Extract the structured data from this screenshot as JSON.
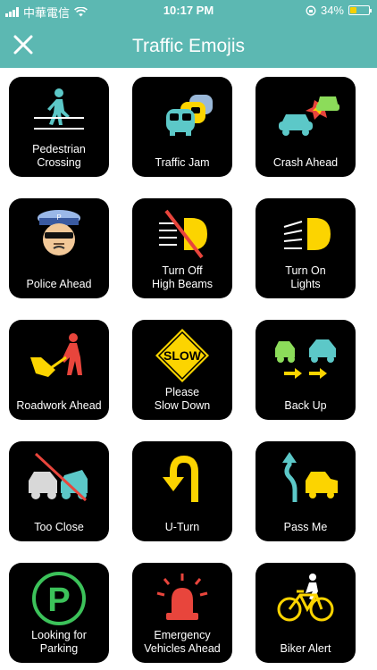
{
  "status_bar": {
    "carrier": "中華電信",
    "time": "10:17 PM",
    "battery": "34%",
    "battery_level": 0.34
  },
  "header": {
    "title": "Traffic Emojis",
    "close_icon": "close-icon"
  },
  "tiles": [
    {
      "label": "Pedestrian\nCrossing",
      "icon": "pedestrian-icon"
    },
    {
      "label": "Traffic Jam",
      "icon": "traffic-jam-icon"
    },
    {
      "label": "Crash Ahead",
      "icon": "crash-icon"
    },
    {
      "label": "Police Ahead",
      "icon": "police-icon"
    },
    {
      "label": "Turn Off\nHigh Beams",
      "icon": "high-beams-off-icon"
    },
    {
      "label": "Turn On\nLights",
      "icon": "lights-on-icon"
    },
    {
      "label": "Roadwork Ahead",
      "icon": "roadwork-icon"
    },
    {
      "label": "Please\nSlow Down",
      "icon": "slow-sign-icon"
    },
    {
      "label": "Back Up",
      "icon": "back-up-icon"
    },
    {
      "label": "Too Close",
      "icon": "too-close-icon"
    },
    {
      "label": "U-Turn",
      "icon": "u-turn-icon"
    },
    {
      "label": "Pass Me",
      "icon": "pass-me-icon"
    },
    {
      "label": "Looking for\nParking",
      "icon": "parking-icon"
    },
    {
      "label": "Emergency\nVehicles Ahead",
      "icon": "siren-icon"
    },
    {
      "label": "Biker Alert",
      "icon": "bicycle-icon"
    }
  ],
  "sign_text": {
    "slow": "SLOW",
    "police_cap": "P",
    "parking": "P"
  },
  "colors": {
    "header": "#5cb8b2",
    "tile": "#000000",
    "yellow": "#fcd400",
    "red": "#e8453c",
    "teal": "#5cc8c8",
    "green": "#3cc25a"
  }
}
